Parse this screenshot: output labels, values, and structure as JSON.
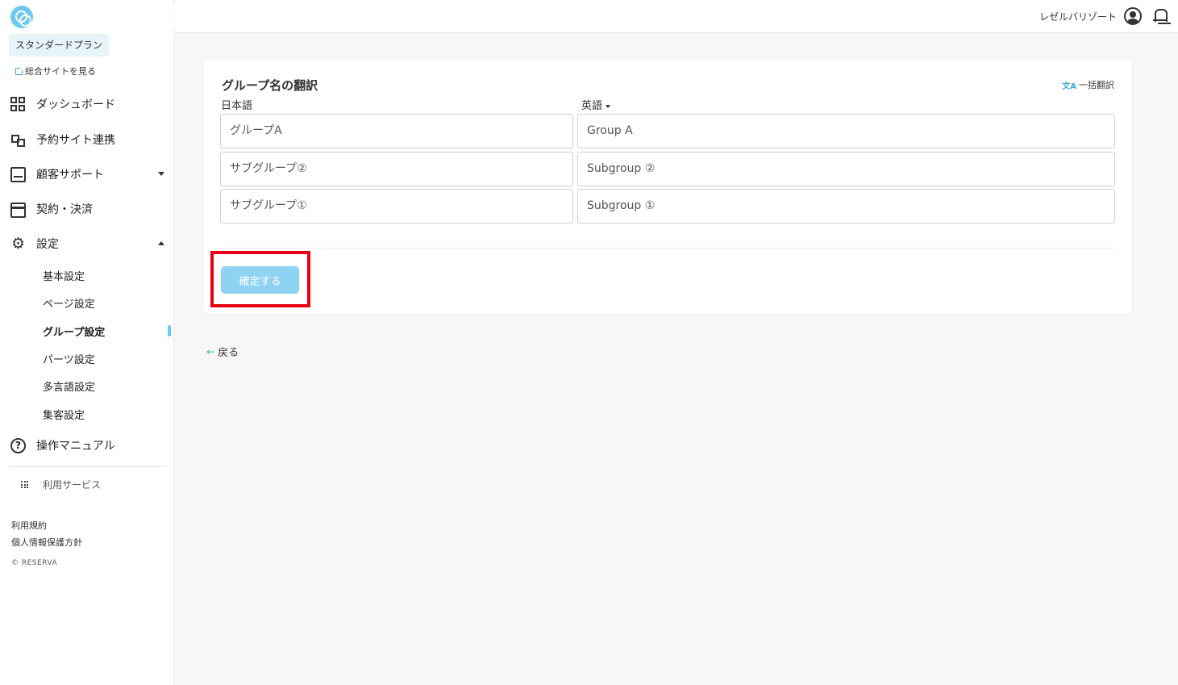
{
  "app": {
    "plan_label": "スタンダードプラン",
    "site_link_label": "総合サイトを見る"
  },
  "sidebar": {
    "items": [
      {
        "label": "ダッシュボード",
        "icon": "dashboard-icon"
      },
      {
        "label": "予約サイト連携",
        "icon": "site-link-icon"
      },
      {
        "label": "顧客サポート",
        "icon": "inbox-icon"
      },
      {
        "label": "契約・決済",
        "icon": "credit-card-icon"
      },
      {
        "label": "設定",
        "icon": "gear-icon"
      },
      {
        "label": "操作マニュアル",
        "icon": "help-icon"
      }
    ],
    "settings_sub": [
      {
        "label": "基本設定"
      },
      {
        "label": "ページ設定"
      },
      {
        "label": "グループ設定",
        "active": true
      },
      {
        "label": "パーツ設定"
      },
      {
        "label": "多言語設定"
      },
      {
        "label": "集客設定"
      }
    ],
    "services_label": "利用サービス",
    "footer": {
      "terms": "利用規約",
      "privacy": "個人情報保護方針",
      "copyright": "© RESERVA"
    }
  },
  "header": {
    "user_name": "レゼルバリゾート"
  },
  "card": {
    "title": "グループ名の翻訳",
    "bulk_translate": "一括翻訳",
    "source_lang": "日本語",
    "target_lang": "英語",
    "rows": [
      {
        "ja": "グループA",
        "en": "Group A"
      },
      {
        "ja": "サブグループ②",
        "en": "Subgroup ②"
      },
      {
        "ja": "サブグループ①",
        "en": "Subgroup ①"
      }
    ],
    "confirm_label": "確定する"
  },
  "back_label": "戻る",
  "colors": {
    "accent": "#6cc9ef",
    "button_disabled": "#8fd3f3",
    "highlight": "#e60012"
  }
}
